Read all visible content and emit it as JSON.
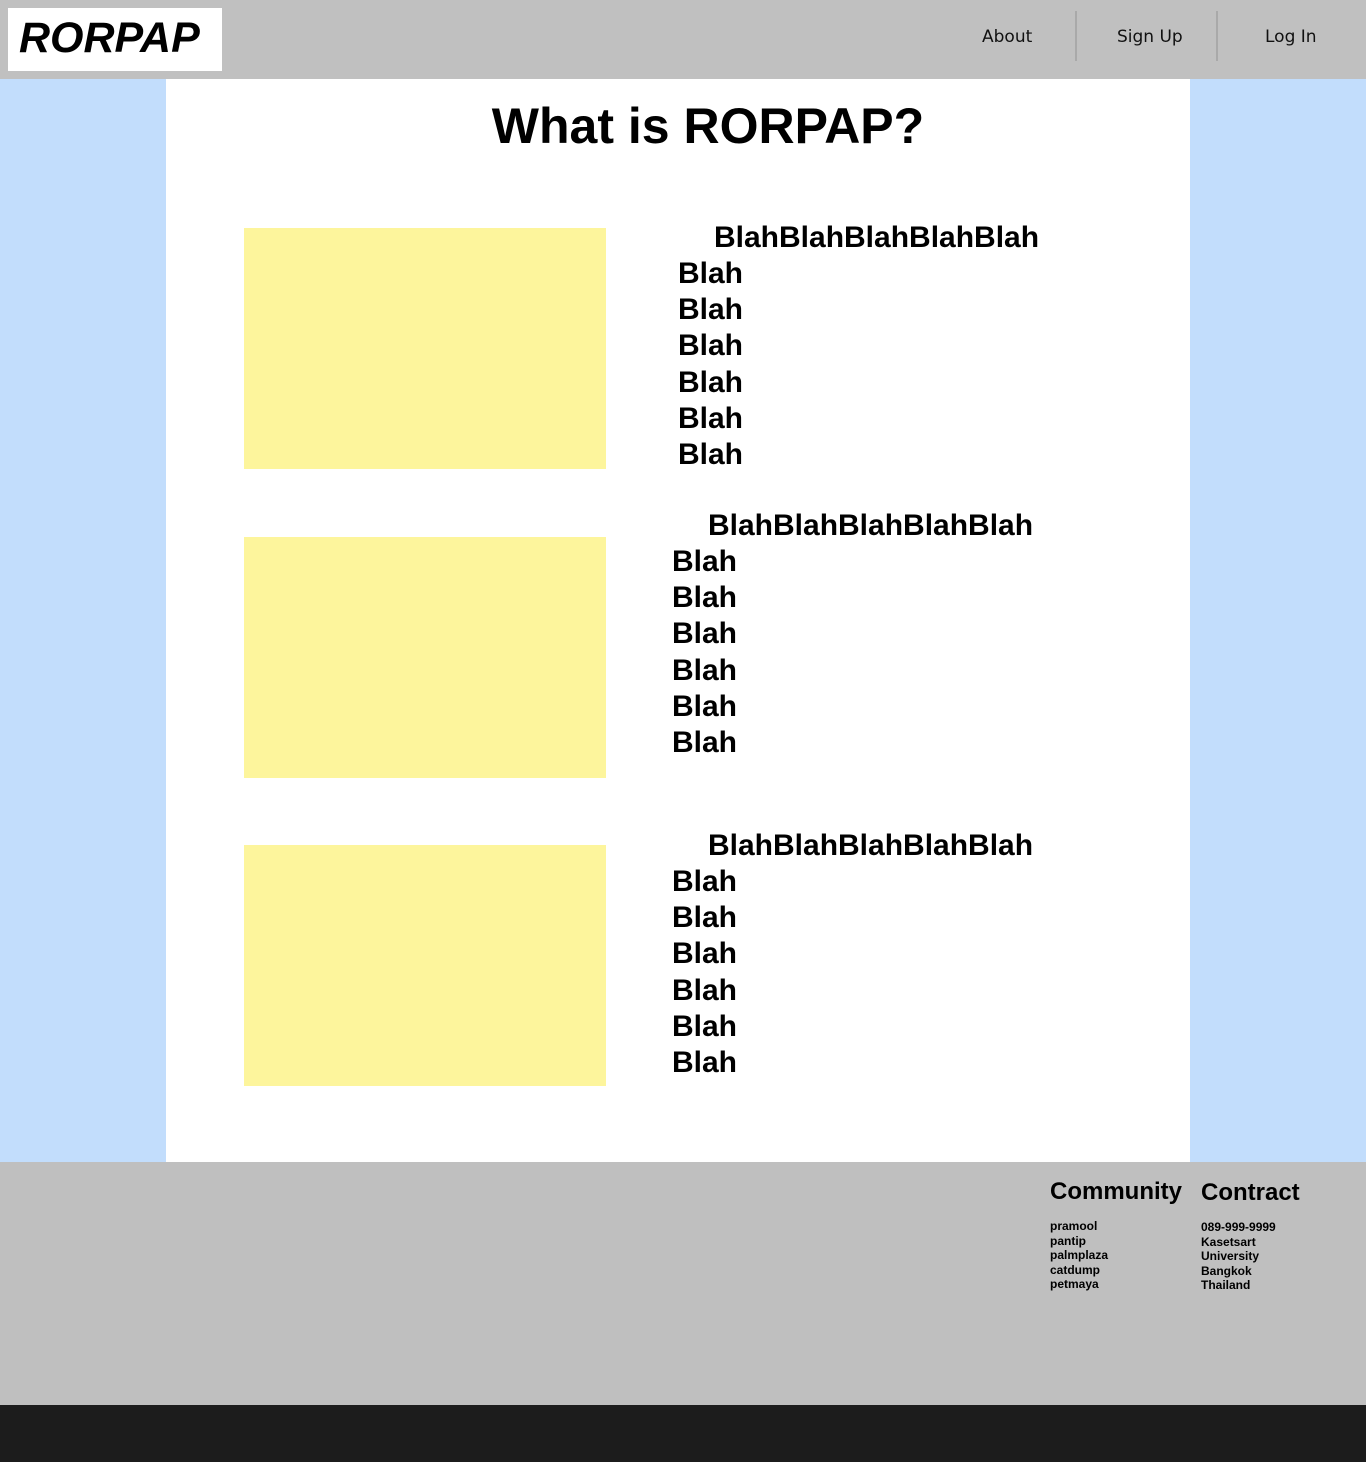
{
  "header": {
    "logo": "RORPAP",
    "nav": [
      "About",
      "Sign Up",
      "Log In"
    ]
  },
  "main": {
    "title": "What is RORPAP?",
    "features": [
      {
        "heading": "BlahBlahBlahBlahBlah",
        "lines": [
          "Blah",
          "Blah",
          "Blah",
          "Blah",
          "Blah",
          "Blah"
        ]
      },
      {
        "heading": "BlahBlahBlahBlahBlah",
        "lines": [
          "Blah",
          "Blah",
          "Blah",
          "Blah",
          "Blah",
          "Blah"
        ]
      },
      {
        "heading": "BlahBlahBlahBlahBlah",
        "lines": [
          "Blah",
          "Blah",
          "Blah",
          "Blah",
          "Blah",
          "Blah"
        ]
      }
    ]
  },
  "footer": {
    "community": {
      "heading": "Community",
      "links": [
        "pramool",
        "pantip",
        "palmplaza",
        "catdump",
        "petmaya"
      ]
    },
    "contract": {
      "heading": "Contract",
      "lines": [
        "089-999-9999",
        "Kasetsart",
        "University",
        "Bangkok",
        "Thailand"
      ]
    }
  },
  "colors": {
    "header_bg": "#c0c0c0",
    "page_bg": "#c2ddfc",
    "content_bg": "#ffffff",
    "image_placeholder": "#fdf59c",
    "footer_bg": "#bfbfbf",
    "bottom_bar": "#1c1c1c"
  }
}
